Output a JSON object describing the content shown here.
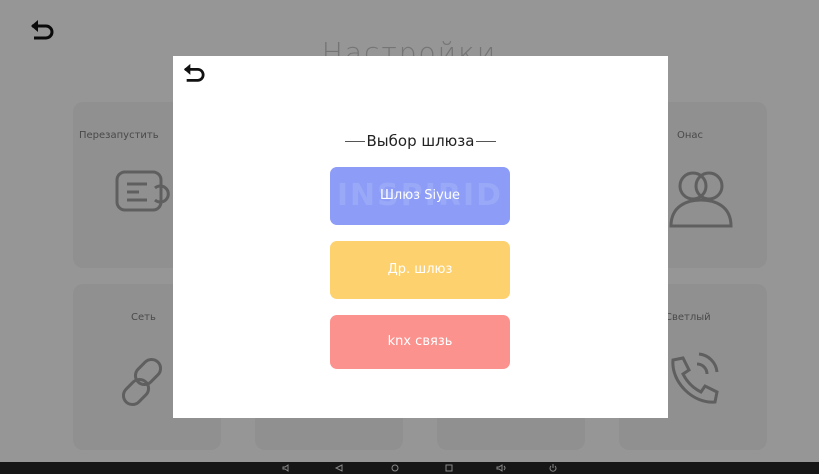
{
  "page_title": "Настройки",
  "tiles": {
    "restart": "Перезапустить",
    "about": "Онас",
    "network": "Сеть",
    "light": "Светлый"
  },
  "dialog": {
    "title": "Выбор шлюза",
    "options": [
      {
        "label": "Шлюз Siyue",
        "color": "#8c9cf7"
      },
      {
        "label": "Др. шлюз",
        "color": "#fdd16e"
      },
      {
        "label": "knx связь",
        "color": "#fb928e"
      }
    ],
    "watermark": "INSPIRID"
  },
  "colors": {
    "overlay": "rgba(0,0,0,0.38)",
    "navbar": "#161616"
  },
  "icons": [
    "back-arrow-icon",
    "restart-icon",
    "people-icon",
    "link-icon",
    "phone-icon",
    "volume-icon",
    "back-triangle-icon",
    "home-circle-icon",
    "recents-square-icon",
    "power-icon"
  ]
}
